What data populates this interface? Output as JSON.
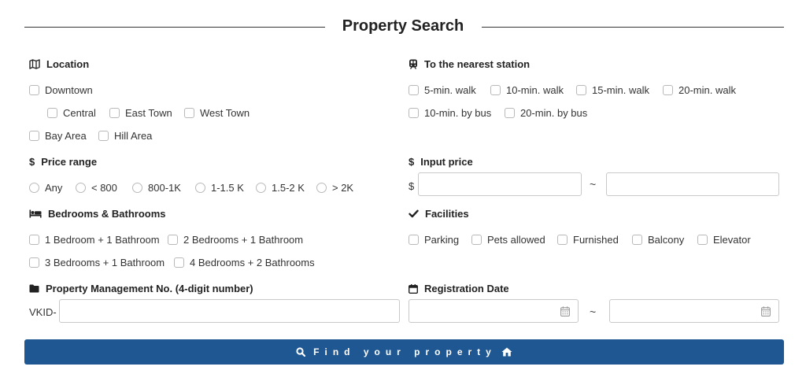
{
  "header": {
    "title": "Property Search"
  },
  "location": {
    "label": "Location",
    "options": [
      "Downtown",
      "Central",
      "East Town",
      "West Town",
      "Bay Area",
      "Hill Area"
    ]
  },
  "station": {
    "label": "To the nearest station",
    "options": [
      "5-min. walk",
      "10-min. walk",
      "15-min. walk",
      "20-min. walk",
      "10-min. by bus",
      "20-min. by bus"
    ]
  },
  "price_range": {
    "label": "Price range",
    "options": [
      "Any",
      "< 800",
      "800-1K",
      "1-1.5 K",
      "1.5-2 K",
      "> 2K"
    ]
  },
  "input_price": {
    "label": "Input price",
    "prefix": "$",
    "min_value": "",
    "max_value": "",
    "separator": "~"
  },
  "rooms": {
    "label": "Bedrooms & Bathrooms",
    "options": [
      "1 Bedroom + 1 Bathroom",
      "2 Bedrooms + 1 Bathroom",
      "3 Bedrooms + 1 Bathroom",
      "4 Bedrooms + 2 Bathrooms"
    ]
  },
  "facilities": {
    "label": "Facilities",
    "options": [
      "Parking",
      "Pets allowed",
      "Furnished",
      "Balcony",
      "Elevator"
    ]
  },
  "management": {
    "label": "Property Management No. (4-digit number)",
    "prefix": "VKID-",
    "value": ""
  },
  "registration": {
    "label": "Registration Date",
    "from_value": "",
    "to_value": "",
    "separator": "~"
  },
  "search_button": {
    "label": "Find your property"
  },
  "colors": {
    "button_bg": "#1f5793",
    "text": "#333333",
    "border": "#c9c9c9"
  }
}
